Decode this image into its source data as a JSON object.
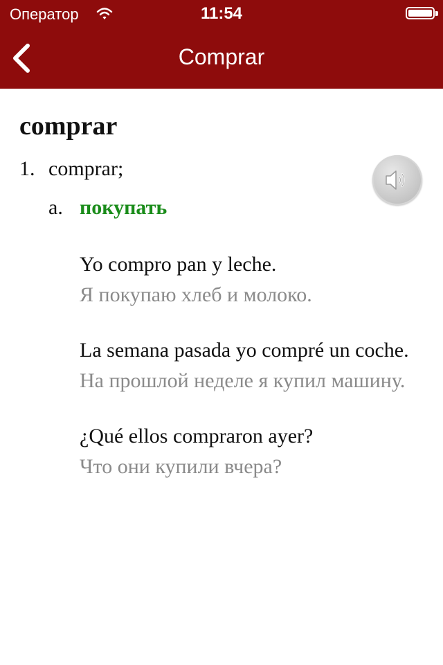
{
  "status_bar": {
    "carrier": "Оператор",
    "time": "11:54"
  },
  "nav": {
    "title": "Comprar",
    "back_icon": "chevron-left-icon"
  },
  "entry": {
    "headword": "comprar",
    "sense_number": "1.",
    "sense_text": "comprar;",
    "sub_letter": "a.",
    "translation": "покупать",
    "translation_color": "#1a8c1a",
    "speaker_icon": "speaker-icon",
    "examples": [
      {
        "source": "Yo compro pan y leche.",
        "translation": "Я покупаю хлеб и молоко."
      },
      {
        "source": "La semana pasada yo compré un coche.",
        "translation": "На прошлой неделе я купил машину."
      },
      {
        "source": "¿Qué ellos compraron ayer?",
        "translation": "Что они купили вчера?"
      }
    ]
  },
  "colors": {
    "header": "#8e0c0c",
    "example_translation": "#8a8a8a"
  }
}
